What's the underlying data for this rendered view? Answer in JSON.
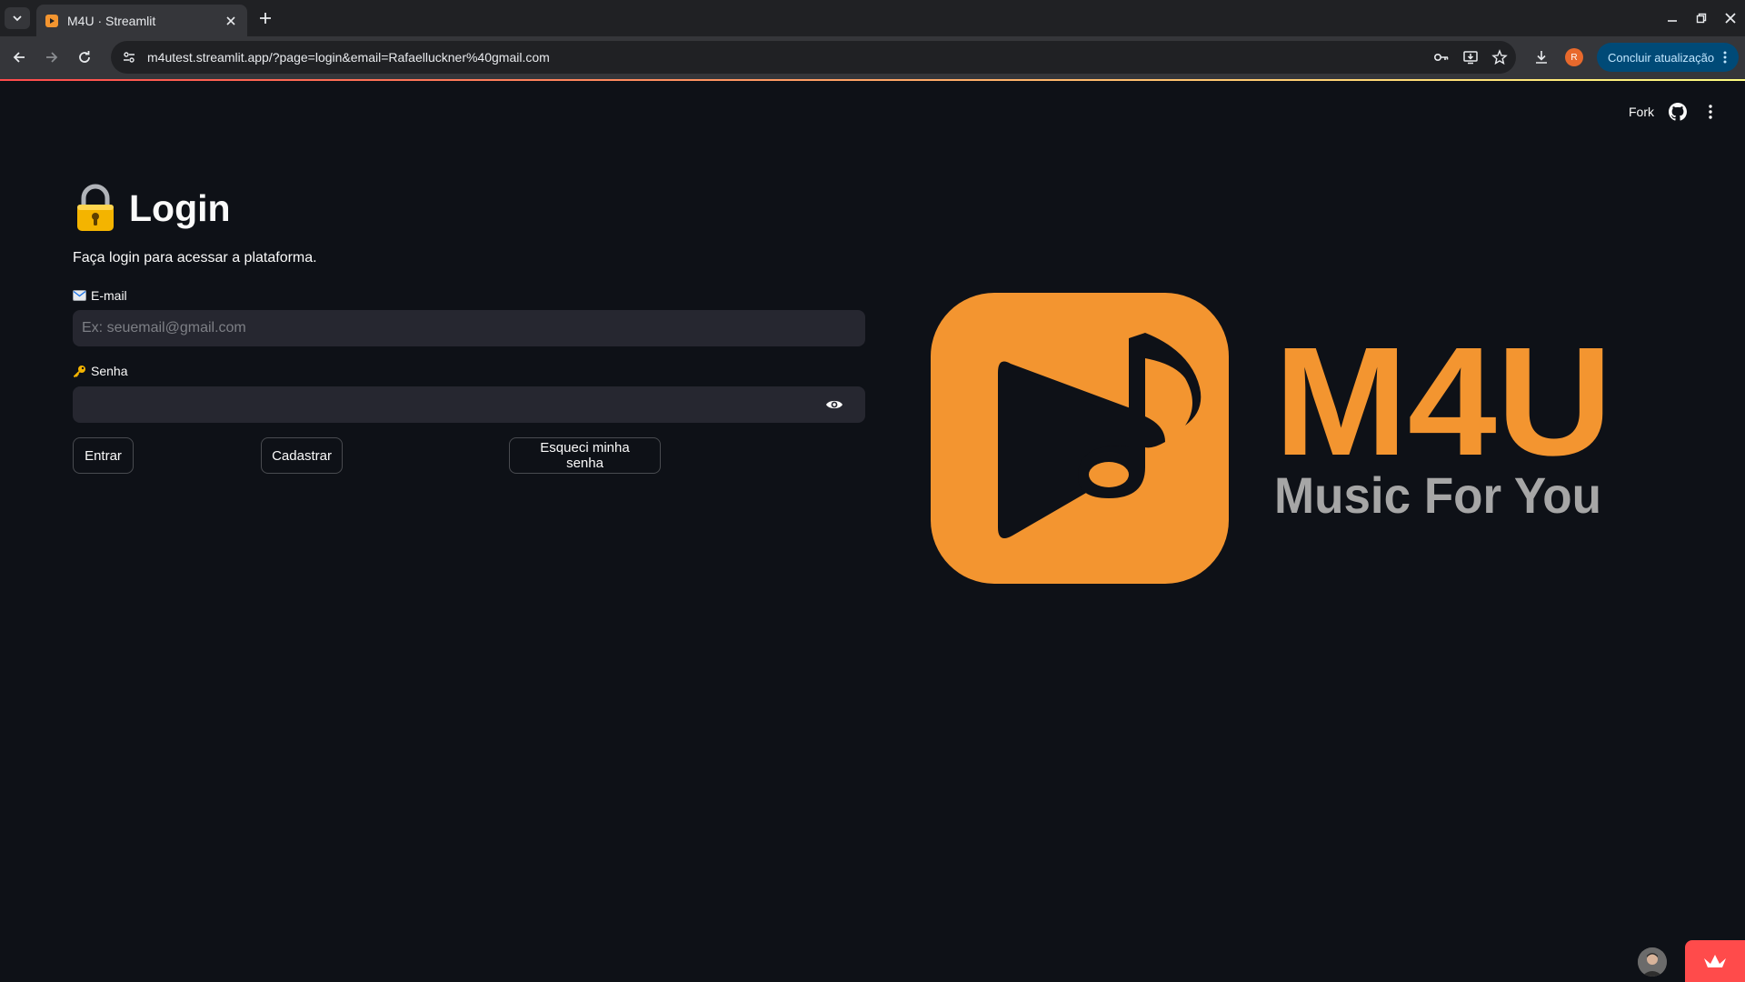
{
  "browser": {
    "tab_title": "M4U · Streamlit",
    "url": "m4utest.streamlit.app/?page=login&email=Rafaelluckner%40gmail.com",
    "profile_initial": "R",
    "update_label": "Concluir atualização"
  },
  "header": {
    "fork_label": "Fork"
  },
  "login": {
    "title": "Login",
    "subtitle": "Faça login para acessar a plataforma.",
    "email_label": "E-mail",
    "email_placeholder": "Ex: seuemail@gmail.com",
    "email_value": "",
    "password_label": "Senha",
    "password_value": "",
    "enter_label": "Entrar",
    "register_label": "Cadastrar",
    "forgot_label": "Esqueci minha senha"
  },
  "logo": {
    "brand": "M4U",
    "tagline": "Music For You",
    "brand_color": "#f39530",
    "tagline_color": "#a6a6a6"
  },
  "icons": {
    "tab_list": "chevron-down-icon",
    "close": "close-icon",
    "new_tab": "plus-icon",
    "back": "arrow-left-icon",
    "forward": "arrow-right-icon",
    "reload": "reload-icon",
    "password_key": "key-icon",
    "install": "install-app-icon",
    "bookmark": "star-icon",
    "downloads": "download-icon",
    "github": "github-icon",
    "menu": "kebab-menu-icon",
    "eye": "eye-icon",
    "lock": "lock-icon"
  },
  "colors": {
    "accent": "#ff4b4b",
    "background": "#0e1117",
    "input_bg": "#262730"
  }
}
